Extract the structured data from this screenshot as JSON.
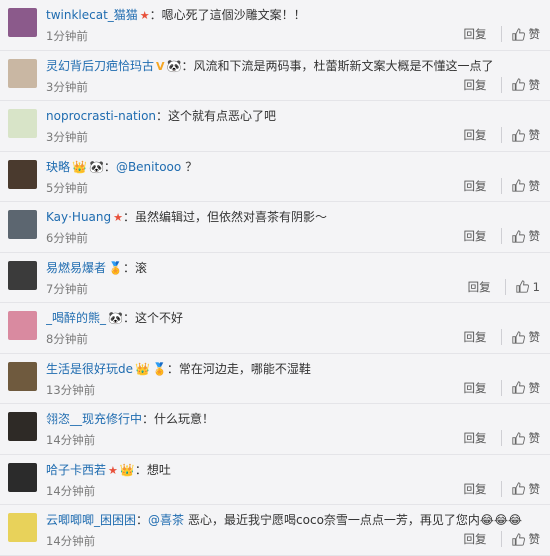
{
  "comments": [
    {
      "name": "twinklecat_猫猫",
      "badges": [
        "star"
      ],
      "text": "：嗯心死了這個沙雕文案！！",
      "time": "1分钟前",
      "reply": "回复",
      "like": "赞",
      "name_color": "blue",
      "avatar_color": "#8b5a8b"
    },
    {
      "name": "灵幻背后刀疤恰玛古",
      "badges": [
        "v",
        "panda"
      ],
      "text": "：风流和下流是两码事，杜蕾斯新文案大概是不懂这一点了",
      "time": "3分钟前",
      "reply": "回复",
      "like": "赞",
      "name_color": "blue",
      "avatar_color": "#c9b7a3"
    },
    {
      "name": "noprocrasti-nation",
      "badges": [],
      "text": "：这个就有点恶心了吧",
      "time": "3分钟前",
      "reply": "回复",
      "like": "赞",
      "name_color": "blue",
      "avatar_color": "#d8e4c8"
    },
    {
      "name": "玦略",
      "badges": [
        "crown",
        "panda"
      ],
      "text": "：",
      "mention": "@Benitooo",
      "tail": "？",
      "time": "5分钟前",
      "reply": "回复",
      "like": "赞",
      "name_color": "blue",
      "avatar_color": "#4a3a2e"
    },
    {
      "name": "Kay·Huang",
      "badges": [
        "star"
      ],
      "text": "：虽然编辑过，但依然对喜茶有阴影～",
      "time": "6分钟前",
      "reply": "回复",
      "like": "赞",
      "name_color": "blue",
      "avatar_color": "#5c6670"
    },
    {
      "name": "易燃易爆者",
      "badges": [
        "medal"
      ],
      "text": "：滚",
      "time": "7分钟前",
      "reply": "回复",
      "like": "1",
      "name_color": "blue",
      "avatar_color": "#3b3b3b"
    },
    {
      "name": "_喝醉的熊_",
      "badges": [
        "panda"
      ],
      "text": "：这个不好",
      "time": "8分钟前",
      "reply": "回复",
      "like": "赞",
      "name_color": "blue",
      "avatar_color": "#d98aa0"
    },
    {
      "name": "生活是很好玩de",
      "badges": [
        "crown",
        "medal"
      ],
      "text": "：常在河边走，哪能不湿鞋",
      "time": "13分钟前",
      "reply": "回复",
      "like": "赞",
      "name_color": "blue",
      "avatar_color": "#6f5a3e"
    },
    {
      "name": "翎恣__现充修行中",
      "badges": [],
      "text": "：什么玩意！",
      "time": "14分钟前",
      "reply": "回复",
      "like": "赞",
      "name_color": "blue",
      "avatar_color": "#2e2a26"
    },
    {
      "name": "哈子卡西若",
      "badges": [
        "star",
        "crown"
      ],
      "text": "：想吐",
      "time": "14分钟前",
      "reply": "回复",
      "like": "赞",
      "name_color": "blue",
      "avatar_color": "#2b2b2b"
    },
    {
      "name": "云唧唧唧_困困困",
      "badges": [],
      "text": "：",
      "mention": "@喜茶",
      "tail": "恶心，最近我宁愿喝coco奈雪一点点一芳，再见了您内😂😂😂",
      "time": "14分钟前",
      "reply": "回复",
      "like": "赞",
      "name_color": "blue",
      "avatar_color": "#e8d25a"
    }
  ],
  "colors": {
    "name": "#1f6cb0",
    "time": "#7a7a7a",
    "bg": "#f4f4f6"
  }
}
